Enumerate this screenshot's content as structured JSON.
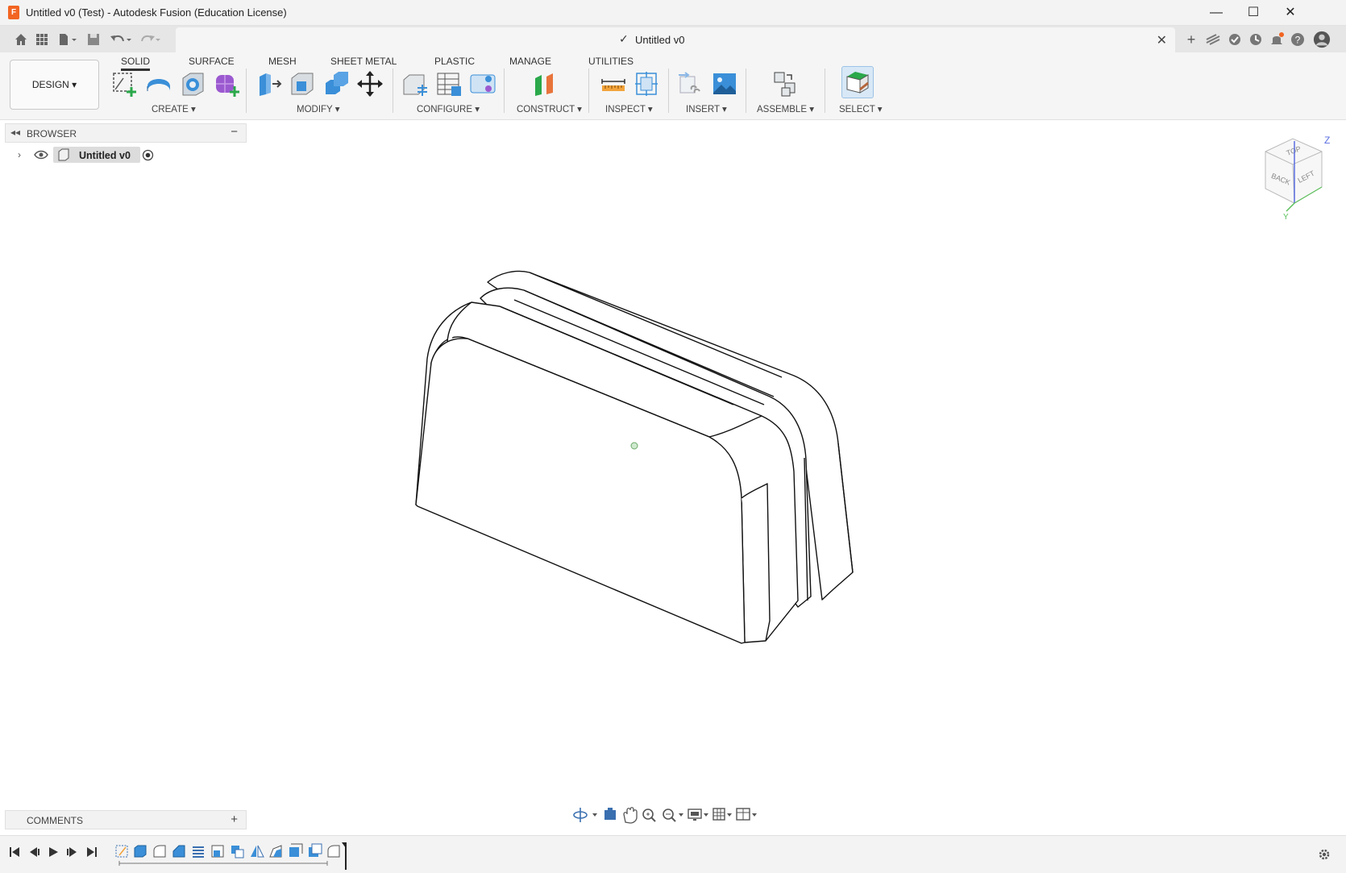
{
  "window": {
    "title": "Untitled v0 (Test) - Autodesk Fusion (Education License)",
    "minimize": "—",
    "maximize": "☐",
    "close": "✕"
  },
  "document_tab": {
    "name": "Untitled v0",
    "saved_icon": "✓",
    "close": "✕"
  },
  "workspace": {
    "label": "DESIGN ▾"
  },
  "tabs": [
    {
      "label": "SOLID",
      "active": true
    },
    {
      "label": "SURFACE"
    },
    {
      "label": "MESH"
    },
    {
      "label": "SHEET METAL"
    },
    {
      "label": "PLASTIC"
    },
    {
      "label": "MANAGE"
    },
    {
      "label": "UTILITIES"
    }
  ],
  "groups": [
    {
      "label": "CREATE ▾"
    },
    {
      "label": "MODIFY ▾"
    },
    {
      "label": "CONFIGURE ▾"
    },
    {
      "label": "CONSTRUCT ▾"
    },
    {
      "label": "INSPECT ▾"
    },
    {
      "label": "INSERT ▾"
    },
    {
      "label": "ASSEMBLE ▾"
    },
    {
      "label": "SELECT ▾"
    }
  ],
  "browser": {
    "title": "BROWSER",
    "collapse": "◂◂",
    "minimize": "−",
    "root_item": "Untitled v0"
  },
  "comments": {
    "title": "COMMENTS",
    "add": "+"
  },
  "viewcube": {
    "top": "TOP",
    "back": "BACK",
    "left": "LEFT",
    "axis_z": "Z",
    "axis_y": "Y"
  },
  "colors": {
    "accent_orange": "#f26522",
    "icon_blue": "#3a8fd8",
    "icon_green": "#2aa84a",
    "icon_purple": "#9b59d0"
  }
}
